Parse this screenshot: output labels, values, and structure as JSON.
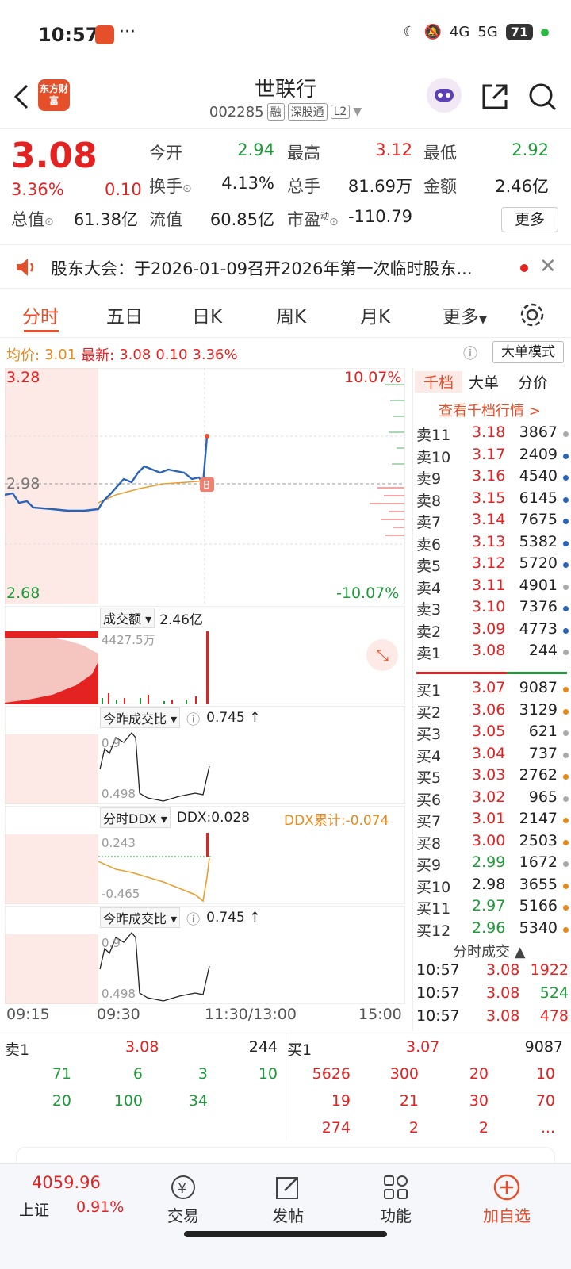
{
  "status": {
    "time": "10:57",
    "signal1": "4G",
    "signal2": "5G",
    "battery": "71"
  },
  "header": {
    "title": "世联行",
    "code": "002285",
    "tags": [
      "融",
      "深股通",
      "L2"
    ],
    "logo_text": "东方财富"
  },
  "quote": {
    "price": "3.08",
    "change_pct": "3.36%",
    "change_val": "0.10",
    "fields": [
      {
        "label": "今开",
        "value": "2.94",
        "color": "green"
      },
      {
        "label": "最高",
        "value": "3.12",
        "color": "red"
      },
      {
        "label": "最低",
        "value": "2.92",
        "color": "green"
      },
      {
        "label": "换手",
        "value": "4.13%",
        "color": "black"
      },
      {
        "label": "总手",
        "value": "81.69万",
        "color": "black"
      },
      {
        "label": "金额",
        "value": "2.46亿",
        "color": "black"
      },
      {
        "label": "总值",
        "value": "61.38亿",
        "color": "black"
      },
      {
        "label": "流值",
        "value": "60.85亿",
        "color": "black"
      },
      {
        "label": "市盈",
        "value": "-110.79",
        "color": "black"
      }
    ],
    "more_label": "更多",
    "pe_superscript": "动"
  },
  "notice": {
    "text": "股东大会：于2026-01-09召开2026年第一次临时股东..."
  },
  "tabs": [
    "分时",
    "五日",
    "日K",
    "周K",
    "月K",
    "更多"
  ],
  "avgrow": {
    "avg_label": "均价:",
    "avg_value": "3.01",
    "latest_label": "最新:",
    "latest_value": "3.08",
    "chg": "0.10",
    "pct": "3.36%",
    "big_order_label": "大单模式"
  },
  "chart": {
    "price_top": "3.28",
    "price_mid": "2.98",
    "price_bottom": "2.68",
    "pct_top": "10.07%",
    "pct_bottom": "-10.07%",
    "vol_label": "成交额",
    "vol_value": "2.46亿",
    "vol_max": "4427.5万",
    "ratio_label": "今昨成交比",
    "ratio_value": "0.745",
    "ratio_top": "0.9",
    "ratio_bottom": "0.498",
    "ddx_label": "分时DDX",
    "ddx_value": "DDX:0.028",
    "ddx_sum": "DDX累计:-0.074",
    "ddx_top": "0.243",
    "ddx_bottom": "-0.465",
    "ratio2_label": "今昨成交比",
    "ratio2_value": "0.745",
    "ratio2_top": "0.9",
    "ratio2_bottom": "0.498",
    "times": [
      "09:15",
      "09:30",
      "11:30/13:00",
      "15:00"
    ]
  },
  "book": {
    "tabs": [
      "千档",
      "大单",
      "分价"
    ],
    "link": "查看千档行情 >",
    "asks": [
      {
        "l": "卖11",
        "p": "3.18",
        "v": "3867",
        "c": "red",
        "d": "gray"
      },
      {
        "l": "卖10",
        "p": "3.17",
        "v": "2409",
        "c": "red",
        "d": "blue"
      },
      {
        "l": "卖9",
        "p": "3.16",
        "v": "4540",
        "c": "red",
        "d": "blue"
      },
      {
        "l": "卖8",
        "p": "3.15",
        "v": "6145",
        "c": "red",
        "d": "blue"
      },
      {
        "l": "卖7",
        "p": "3.14",
        "v": "7675",
        "c": "red",
        "d": "blue"
      },
      {
        "l": "卖6",
        "p": "3.13",
        "v": "5382",
        "c": "red",
        "d": "blue"
      },
      {
        "l": "卖5",
        "p": "3.12",
        "v": "5720",
        "c": "red",
        "d": "blue"
      },
      {
        "l": "卖4",
        "p": "3.11",
        "v": "4901",
        "c": "red",
        "d": "gray"
      },
      {
        "l": "卖3",
        "p": "3.10",
        "v": "7376",
        "c": "red",
        "d": "blue"
      },
      {
        "l": "卖2",
        "p": "3.09",
        "v": "4773",
        "c": "red",
        "d": "blue"
      },
      {
        "l": "卖1",
        "p": "3.08",
        "v": "244",
        "c": "red",
        "d": "gray"
      }
    ],
    "bids": [
      {
        "l": "买1",
        "p": "3.07",
        "v": "9087",
        "c": "red",
        "d": "orange"
      },
      {
        "l": "买2",
        "p": "3.06",
        "v": "3129",
        "c": "red",
        "d": "orange"
      },
      {
        "l": "买3",
        "p": "3.05",
        "v": "621",
        "c": "red",
        "d": "gray"
      },
      {
        "l": "买4",
        "p": "3.04",
        "v": "737",
        "c": "red",
        "d": "gray"
      },
      {
        "l": "买5",
        "p": "3.03",
        "v": "2762",
        "c": "red",
        "d": "orange"
      },
      {
        "l": "买6",
        "p": "3.02",
        "v": "965",
        "c": "red",
        "d": "gray"
      },
      {
        "l": "买7",
        "p": "3.01",
        "v": "2147",
        "c": "red",
        "d": "orange"
      },
      {
        "l": "买8",
        "p": "3.00",
        "v": "2503",
        "c": "red",
        "d": "orange"
      },
      {
        "l": "买9",
        "p": "2.99",
        "v": "1672",
        "c": "green",
        "d": "gray"
      },
      {
        "l": "买10",
        "p": "2.98",
        "v": "3655",
        "c": "black",
        "d": "orange"
      },
      {
        "l": "买11",
        "p": "2.97",
        "v": "5166",
        "c": "green",
        "d": "orange"
      },
      {
        "l": "买12",
        "p": "2.96",
        "v": "5340",
        "c": "green",
        "d": "orange"
      }
    ],
    "tick_title": "分时成交",
    "ticks": [
      {
        "t": "10:57",
        "p": "3.08",
        "v": "1922",
        "vc": "red"
      },
      {
        "t": "10:57",
        "p": "3.08",
        "v": "524",
        "vc": "green"
      },
      {
        "t": "10:57",
        "p": "3.08",
        "v": "478",
        "vc": "red"
      }
    ]
  },
  "queue": {
    "sell_label": "卖1",
    "sell_price": "3.08",
    "sell_vol": "244",
    "buy_label": "买1",
    "buy_price": "3.07",
    "buy_vol": "9087",
    "sell_rows": [
      [
        "71",
        "6",
        "3",
        "10"
      ],
      [
        "20",
        "100",
        "34",
        ""
      ]
    ],
    "buy_rows": [
      [
        "5626",
        "300",
        "20",
        "10"
      ],
      [
        "19",
        "21",
        "30",
        "70"
      ],
      [
        "274",
        "2",
        "2",
        "..."
      ]
    ]
  },
  "nav": {
    "index_value": "4059.96",
    "index_name": "上证",
    "index_pct": "0.91%",
    "items": [
      "交易",
      "发帖",
      "功能",
      "加自选"
    ]
  }
}
